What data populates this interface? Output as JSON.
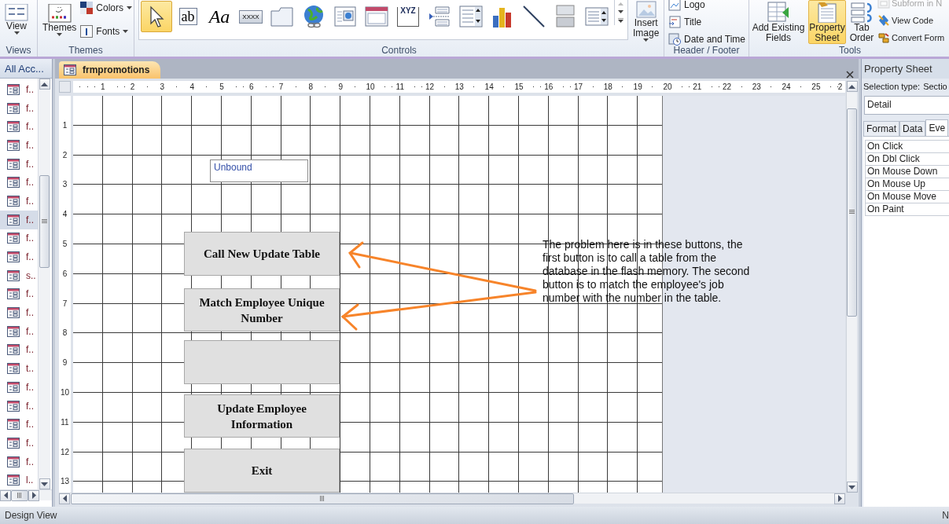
{
  "ribbon": {
    "views": {
      "label": "Views",
      "button": "View"
    },
    "themes": {
      "label": "Themes",
      "button": "Themes",
      "small": [
        "Colors",
        "Fonts"
      ]
    },
    "controls": {
      "label": "Controls",
      "insert_image": "Insert Image",
      "gallery": [
        {
          "kind": "select",
          "selected": true
        },
        {
          "kind": "textbox",
          "text": "ab",
          "selected": false
        },
        {
          "kind": "label",
          "text": "Aa",
          "selected": false
        },
        {
          "kind": "button",
          "text": "XXXX",
          "selected": false
        },
        {
          "kind": "tab",
          "selected": false
        },
        {
          "kind": "hyperlink",
          "selected": false
        },
        {
          "kind": "browser",
          "selected": false
        },
        {
          "kind": "navigation",
          "selected": false
        },
        {
          "kind": "optiongroup",
          "text": "XYZ",
          "selected": false
        },
        {
          "kind": "pagebreak",
          "selected": false
        },
        {
          "kind": "combo",
          "selected": false
        },
        {
          "kind": "chart",
          "selected": false
        },
        {
          "kind": "line",
          "selected": false
        },
        {
          "kind": "toggle",
          "selected": false
        },
        {
          "kind": "listbox",
          "selected": false
        }
      ]
    },
    "header_footer": {
      "label": "Header / Footer",
      "items": [
        "Logo",
        "Title",
        "Date and Time"
      ]
    },
    "tools": {
      "label": "Tools",
      "large": [
        {
          "label": "Add Existing Fields",
          "selected": false
        },
        {
          "label": "Property Sheet",
          "selected": true
        },
        {
          "label": "Tab Order",
          "selected": false
        }
      ],
      "small": [
        {
          "label": "Subform in N",
          "disabled": true
        },
        {
          "label": "View Code",
          "disabled": false
        },
        {
          "label": "Convert Form",
          "disabled": false
        }
      ]
    }
  },
  "nav_pane": {
    "header": "All Acc...",
    "items": [
      {
        "label": "f..",
        "selected": false
      },
      {
        "label": "f..",
        "selected": false
      },
      {
        "label": "f..",
        "selected": false
      },
      {
        "label": "f..",
        "selected": false
      },
      {
        "label": "f..",
        "selected": false
      },
      {
        "label": "f..",
        "selected": false
      },
      {
        "label": "f..",
        "selected": false
      },
      {
        "label": "f..",
        "selected": true
      },
      {
        "label": "f..",
        "selected": false
      },
      {
        "label": "f..",
        "selected": false
      },
      {
        "label": "s..",
        "selected": false
      },
      {
        "label": "f..",
        "selected": false
      },
      {
        "label": "f..",
        "selected": false
      },
      {
        "label": "f..",
        "selected": false
      },
      {
        "label": "f..",
        "selected": false
      },
      {
        "label": "t..",
        "selected": false
      },
      {
        "label": "f..",
        "selected": false
      },
      {
        "label": "f..",
        "selected": false
      },
      {
        "label": "f..",
        "selected": false
      },
      {
        "label": "f..",
        "selected": false
      },
      {
        "label": "f..",
        "selected": false
      },
      {
        "label": "l..",
        "selected": false
      }
    ]
  },
  "document": {
    "tab": "frmpromotions",
    "h_ruler": [
      "1",
      "2",
      "3",
      "4",
      "5",
      "6",
      "7",
      "8",
      "9",
      "10",
      "11",
      "12",
      "13",
      "14",
      "15",
      "16",
      "17",
      "18",
      "19",
      "20",
      "21",
      "22",
      "23",
      "24",
      "25",
      "2"
    ],
    "v_ruler": [
      "1",
      "2",
      "3",
      "4",
      "5",
      "6",
      "7",
      "8",
      "9",
      "10",
      "11",
      "12",
      "13"
    ],
    "controls": [
      {
        "kind": "textbox",
        "text": "Unbound"
      },
      {
        "kind": "button",
        "label": "Call New Update Table"
      },
      {
        "kind": "button",
        "label": "Match Employee Unique Number"
      },
      {
        "kind": "button"
      },
      {
        "kind": "button",
        "label": "Update Employee Information"
      },
      {
        "kind": "button",
        "label": "Exit"
      }
    ],
    "note": "The problem here is in these buttons, the first button is to call a table from the database in the flash memory. The second button is to match the employee's job number with the number in the table."
  },
  "property_sheet": {
    "title": "Property Sheet",
    "selection_type": "Selection type:",
    "selection_value": "Sectio",
    "object": "Detail",
    "tabs": [
      {
        "label": "Format",
        "selected": false
      },
      {
        "label": "Data",
        "selected": false
      },
      {
        "label": "Eve",
        "selected": true
      }
    ],
    "properties": [
      "On Click",
      "On Dbl Click",
      "On Mouse Down",
      "On Mouse Up",
      "On Mouse Move",
      "On Paint"
    ]
  },
  "status_bar": {
    "mode": "Design View",
    "indicator": "N"
  }
}
